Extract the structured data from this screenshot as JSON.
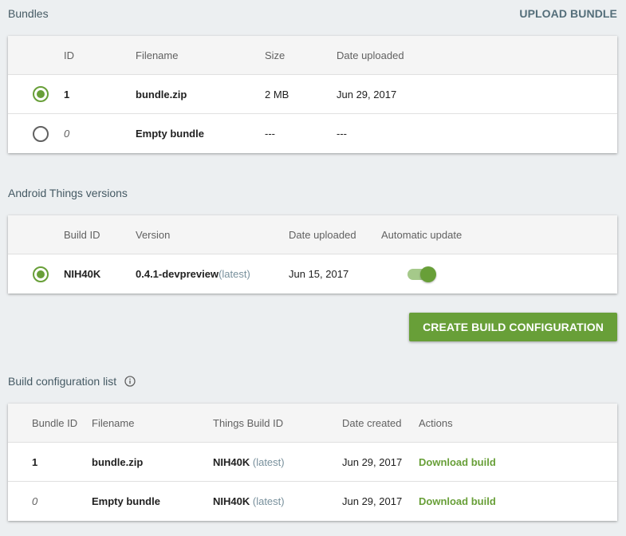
{
  "bundles": {
    "title": "Bundles",
    "upload_label": "UPLOAD BUNDLE",
    "headers": {
      "id": "ID",
      "filename": "Filename",
      "size": "Size",
      "date": "Date uploaded"
    },
    "rows": [
      {
        "selected": true,
        "id": "1",
        "filename": "bundle.zip",
        "size": "2 MB",
        "date": "Jun 29, 2017"
      },
      {
        "selected": false,
        "id": "0",
        "filename": "Empty bundle",
        "size": "---",
        "date": "---"
      }
    ]
  },
  "versions": {
    "title": "Android Things versions",
    "headers": {
      "build_id": "Build ID",
      "version": "Version",
      "date": "Date uploaded",
      "auto": "Automatic update"
    },
    "rows": [
      {
        "selected": true,
        "build_id": "NIH40K",
        "version": "0.4.1-devpreview",
        "tag": "(latest)",
        "date": "Jun 15, 2017",
        "auto_update": true
      }
    ]
  },
  "create_button_label": "CREATE BUILD CONFIGURATION",
  "configs": {
    "title": "Build configuration list",
    "headers": {
      "bundle_id": "Bundle ID",
      "filename": "Filename",
      "things_build": "Things Build ID",
      "date": "Date created",
      "actions": "Actions"
    },
    "rows": [
      {
        "bundle_id": "1",
        "filename": "bundle.zip",
        "build_id": "NIH40K",
        "tag": "(latest)",
        "date": "Jun 29, 2017",
        "action": "Download build"
      },
      {
        "bundle_id": "0",
        "filename": "Empty bundle",
        "build_id": "NIH40K",
        "tag": "(latest)",
        "date": "Jun 29, 2017",
        "action": "Download build"
      }
    ]
  },
  "colors": {
    "accent": "#689f38",
    "background": "#eceff1"
  },
  "icons": {
    "info": "info-circle-icon"
  }
}
